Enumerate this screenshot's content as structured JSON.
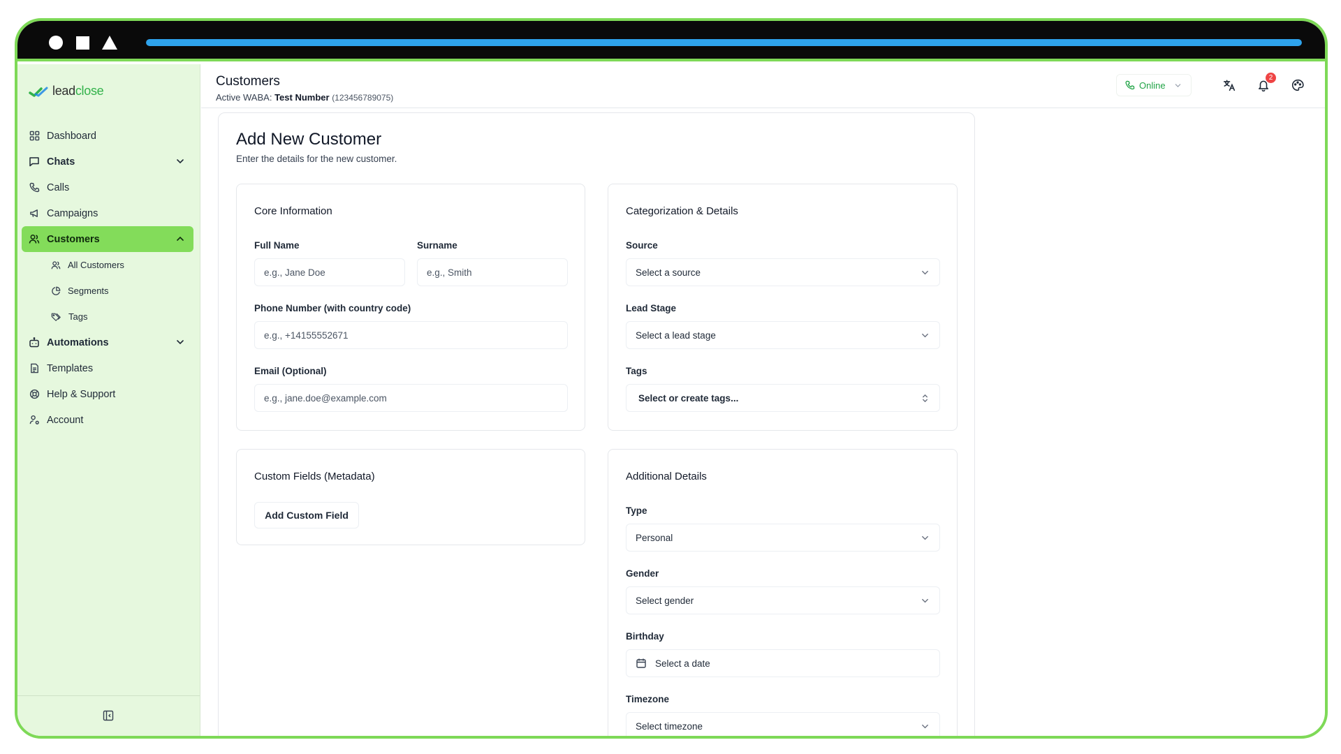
{
  "window": {
    "progress": 1.0,
    "accent_colors": {
      "frame": "#7ed957",
      "progress": "#2ea3ec",
      "sidebar_active": "#83dc5a",
      "online": "#22a447",
      "badge": "#ef4444"
    }
  },
  "brand": {
    "name_part1": "lead",
    "name_part2": "close"
  },
  "sidebar": {
    "items": [
      {
        "label": "Dashboard",
        "icon": "grid-icon"
      },
      {
        "label": "Chats",
        "icon": "message-square-icon",
        "expandable": true
      },
      {
        "label": "Calls",
        "icon": "phone-icon"
      },
      {
        "label": "Campaigns",
        "icon": "megaphone-icon"
      },
      {
        "label": "Customers",
        "icon": "users-icon",
        "active": true,
        "expanded": true
      },
      {
        "label": "All Customers",
        "icon": "users-icon"
      },
      {
        "label": "Segments",
        "icon": "pie-chart-icon"
      },
      {
        "label": "Tags",
        "icon": "tags-icon"
      },
      {
        "label": "Automations",
        "icon": "bot-icon",
        "expandable": true
      },
      {
        "label": "Templates",
        "icon": "file-text-icon"
      },
      {
        "label": "Help & Support",
        "icon": "life-buoy-icon"
      },
      {
        "label": "Account",
        "icon": "user-cog-icon"
      }
    ]
  },
  "header": {
    "title": "Customers",
    "waba_prefix": "Active WABA:",
    "waba_name": "Test Number",
    "waba_number": "(123456789075)",
    "status": "Online",
    "notification_count": "2"
  },
  "form": {
    "title": "Add New Customer",
    "subtitle": "Enter the details for the new customer.",
    "core": {
      "title": "Core Information",
      "full_name_label": "Full Name",
      "full_name_placeholder": "e.g., Jane Doe",
      "surname_label": "Surname",
      "surname_placeholder": "e.g., Smith",
      "phone_label": "Phone Number (with country code)",
      "phone_placeholder": "e.g., +14155552671",
      "email_label": "Email (Optional)",
      "email_placeholder": "e.g., jane.doe@example.com"
    },
    "categorization": {
      "title": "Categorization & Details",
      "source_label": "Source",
      "source_value": "Select a source",
      "lead_stage_label": "Lead Stage",
      "lead_stage_value": "Select a lead stage",
      "tags_label": "Tags",
      "tags_value": "Select or create tags..."
    },
    "custom": {
      "title": "Custom Fields (Metadata)",
      "add_button": "Add Custom Field"
    },
    "additional": {
      "title": "Additional Details",
      "type_label": "Type",
      "type_value": "Personal",
      "gender_label": "Gender",
      "gender_value": "Select gender",
      "birthday_label": "Birthday",
      "birthday_value": "Select a date",
      "timezone_label": "Timezone",
      "timezone_value": "Select timezone"
    }
  }
}
